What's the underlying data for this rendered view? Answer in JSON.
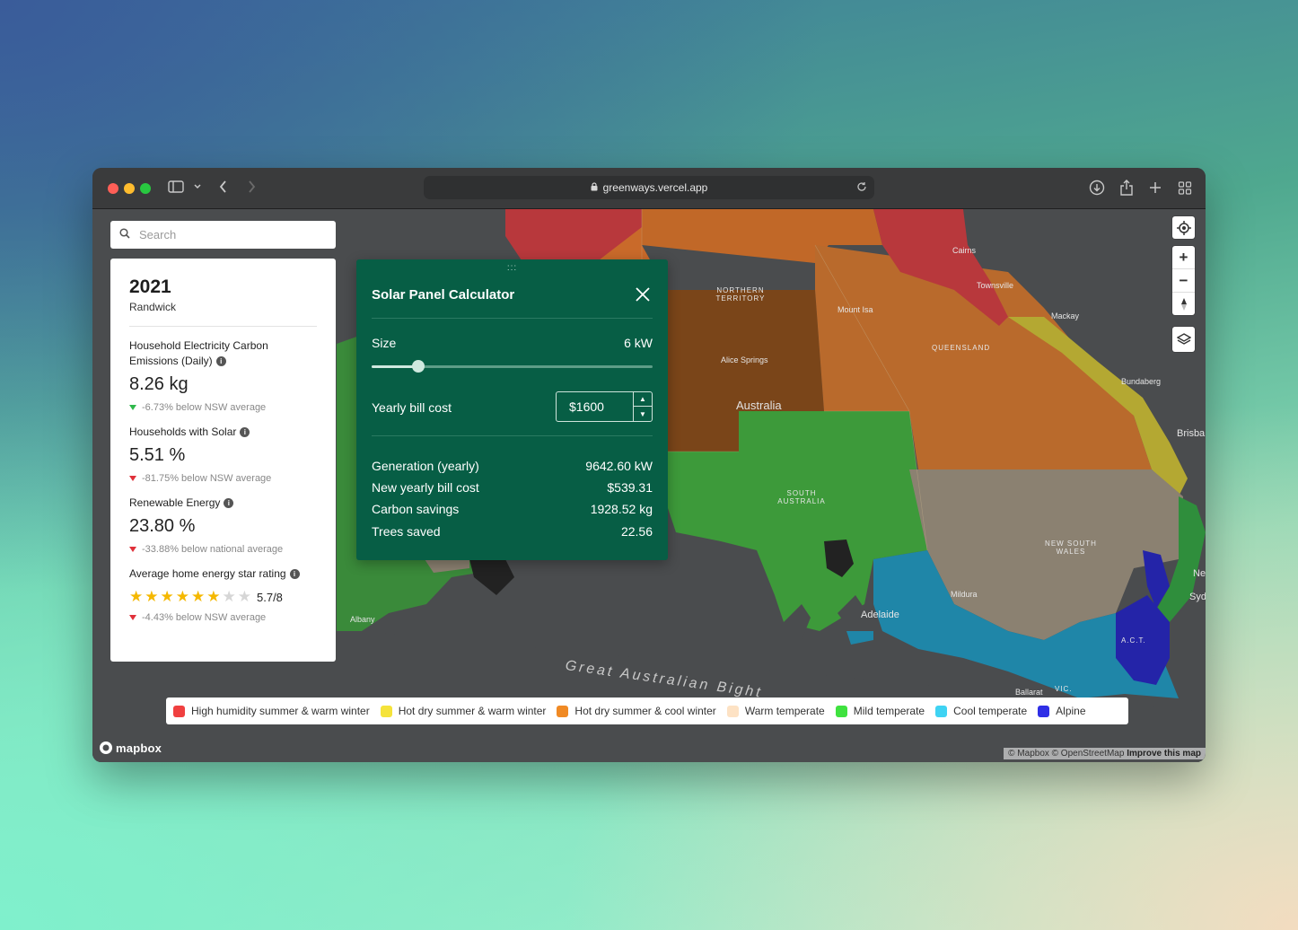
{
  "browser": {
    "url": "greenways.vercel.app"
  },
  "search": {
    "placeholder": "Search"
  },
  "stats": {
    "year": "2021",
    "suburb": "Randwick",
    "items": [
      {
        "label": "Household Electricity Carbon Emissions (Daily)",
        "value": "8.26 kg",
        "comparison": "-6.73% below NSW average",
        "trend_color": "#2fb84b"
      },
      {
        "label": "Households with Solar",
        "value": "5.51 %",
        "comparison": "-81.75% below NSW average",
        "trend_color": "#e0303a"
      },
      {
        "label": "Renewable Energy",
        "value": "23.80 %",
        "comparison": "-33.88% below national average",
        "trend_color": "#e0303a"
      }
    ],
    "star_rating": {
      "label": "Average home energy star rating",
      "rating_text": "5.7/8",
      "stars_value": 5.7,
      "stars_max": 8,
      "comparison": "-4.43% below NSW average",
      "trend_color": "#e0303a"
    }
  },
  "calculator": {
    "drag_handle": ":::",
    "title": "Solar Panel Calculator",
    "size_label": "Size",
    "size_value": "6 kW",
    "size_slider_fraction": 0.165,
    "bill_label": "Yearly bill cost",
    "bill_value": "$1600",
    "results": [
      {
        "label": "Generation (yearly)",
        "value": "9642.60 kW"
      },
      {
        "label": "New yearly bill cost",
        "value": "$539.31"
      },
      {
        "label": "Carbon savings",
        "value": "1928.52 kg"
      },
      {
        "label": "Trees saved",
        "value": "22.56"
      }
    ]
  },
  "map": {
    "labels": {
      "nt": "NORTHERN TERRITORY",
      "qld": "QUEENSLAND",
      "sa": "SOUTH AUSTRALIA",
      "nsw": "NEW SOUTH WALES",
      "act": "A.C.T.",
      "bight": "Great Australian Bight",
      "australia": "Australia",
      "alice": "Alice Springs",
      "mtisa": "Mount Isa",
      "cairns": "Cairns",
      "townsville": "Townsville",
      "mackay": "Mackay",
      "bundaberg": "Bundaberg",
      "brisbane": "Brisba",
      "adelaide": "Adelaide",
      "mildura": "Mildura",
      "albany": "Albany",
      "vic": "VIC.",
      "syd": "Syd",
      "ne": "Ne",
      "ballarat": "Ballarat"
    }
  },
  "legend": [
    {
      "label": "High humidity summer & warm winter",
      "color": "#f04040"
    },
    {
      "label": "Hot dry summer & warm winter",
      "color": "#f5e33a"
    },
    {
      "label": "Hot dry summer & cool winter",
      "color": "#f08a24"
    },
    {
      "label": "Warm temperate",
      "color": "#fde2c4"
    },
    {
      "label": "Mild temperate",
      "color": "#3fe23f"
    },
    {
      "label": "Cool temperate",
      "color": "#3fd3f3"
    },
    {
      "label": "Alpine",
      "color": "#2f2fe6"
    }
  ],
  "footer": {
    "brand": "mapbox",
    "attribution": "© Mapbox © OpenStreetMap",
    "improve": "Improve this map"
  }
}
